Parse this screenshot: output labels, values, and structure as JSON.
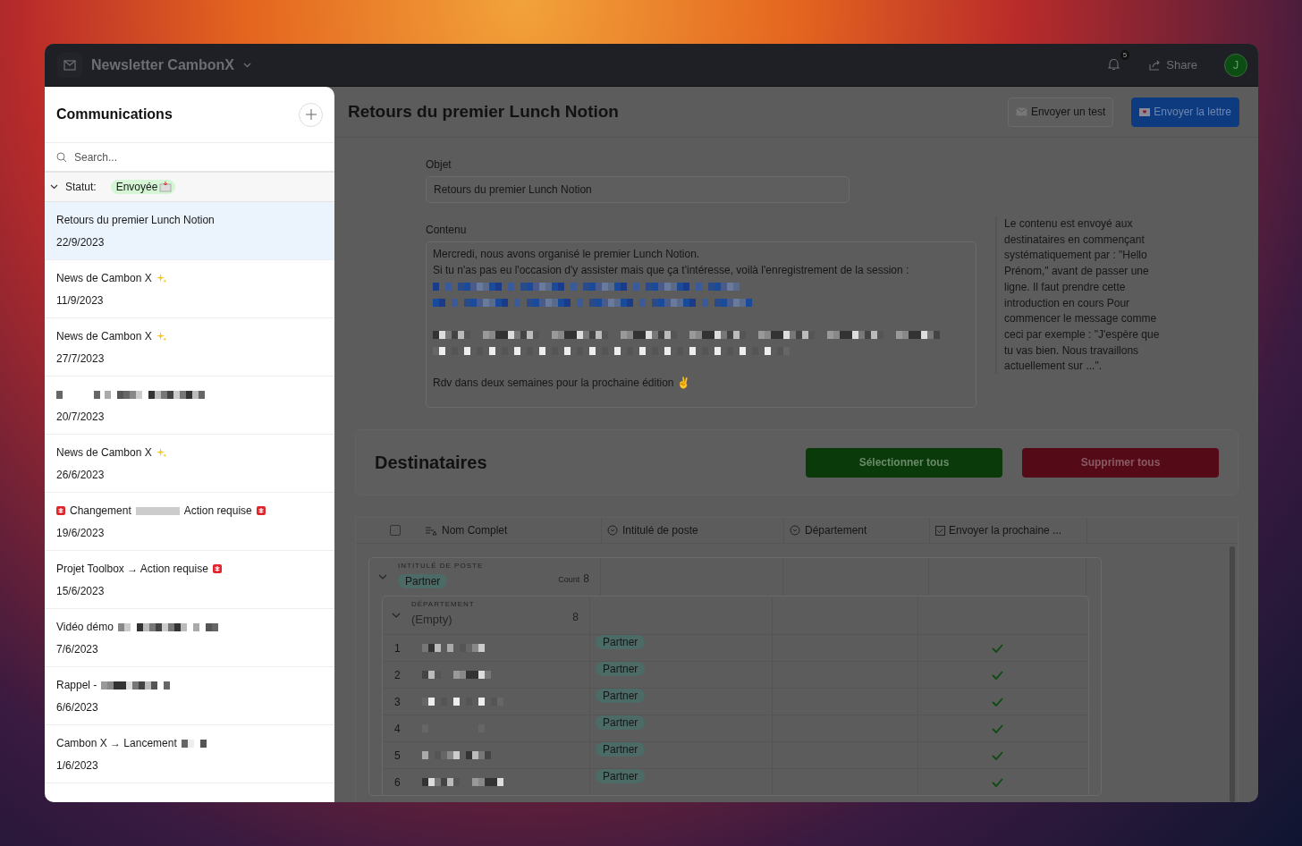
{
  "window": {
    "title": "Newsletter CambonX",
    "notifications": "5",
    "share": "Share",
    "avatar": "J"
  },
  "sidebar": {
    "title": "Communications",
    "search": {
      "placeholder": "Search..."
    },
    "filter": {
      "label": "Statut:",
      "value": "Envoyée",
      "expanded": true
    },
    "items": [
      {
        "selected": true,
        "date": "22/9/2023",
        "segments": [
          {
            "kind": "text",
            "text": "Retours du premier Lunch Notion"
          }
        ]
      },
      {
        "selected": false,
        "date": "11/9/2023",
        "segments": [
          {
            "kind": "text",
            "text": "News de Cambon X"
          },
          {
            "kind": "sparkle"
          }
        ]
      },
      {
        "selected": false,
        "date": "27/7/2023",
        "segments": [
          {
            "kind": "text",
            "text": "News de Cambon X"
          },
          {
            "kind": "sparkle"
          }
        ]
      },
      {
        "selected": false,
        "date": "20/7/2023",
        "segments": [
          {
            "kind": "redacted"
          },
          {
            "kind": "redacted"
          }
        ]
      },
      {
        "selected": false,
        "date": "26/6/2023",
        "segments": [
          {
            "kind": "text",
            "text": "News de Cambon X"
          },
          {
            "kind": "sparkle"
          }
        ]
      },
      {
        "selected": false,
        "date": "19/6/2023",
        "segments": [
          {
            "kind": "alert"
          },
          {
            "kind": "text",
            "text": "Changement"
          },
          {
            "kind": "redacted"
          },
          {
            "kind": "text",
            "text": "Action requise"
          },
          {
            "kind": "alert"
          }
        ]
      },
      {
        "selected": false,
        "date": "15/6/2023",
        "segments": [
          {
            "kind": "text",
            "text": "Projet Toolbox → Action requise"
          },
          {
            "kind": "alert"
          }
        ]
      },
      {
        "selected": false,
        "date": "7/6/2023",
        "segments": [
          {
            "kind": "text",
            "text": "Vidéo démo"
          },
          {
            "kind": "redacted"
          }
        ]
      },
      {
        "selected": false,
        "date": "6/6/2023",
        "segments": [
          {
            "kind": "text",
            "text": "Rappel -"
          },
          {
            "kind": "redacted"
          }
        ]
      },
      {
        "selected": false,
        "date": "1/6/2023",
        "segments": [
          {
            "kind": "text",
            "text": "Cambon X → Lancement"
          },
          {
            "kind": "redacted"
          }
        ]
      }
    ]
  },
  "main": {
    "title": "Retours du premier Lunch Notion",
    "buttons": [
      {
        "kind": "test",
        "label": "Envoyer un test"
      },
      {
        "kind": "send",
        "label": "Envoyer la lettre"
      }
    ],
    "subject": {
      "label": "Objet",
      "value": "Retours du premier Lunch Notion"
    },
    "content": {
      "label": "Contenu",
      "lines": [
        {
          "kind": "text",
          "text": "Mercredi, nous avons organisé le premier Lunch Notion."
        },
        {
          "kind": "text",
          "text": "Si tu n'as pas eu l'occasion d'y assister mais que ça t'intéresse, voilà l'enregistrement de la session :"
        },
        {
          "kind": "link-redacted"
        },
        {
          "kind": "link-redacted"
        },
        {
          "kind": "blank"
        },
        {
          "kind": "redacted"
        },
        {
          "kind": "redacted"
        },
        {
          "kind": "blank"
        },
        {
          "kind": "text",
          "text": "Rdv dans deux semaines pour la prochaine édition ✌"
        }
      ]
    },
    "note": "Le contenu est envoyé aux destinataires en commençant systématiquement par : \"Hello Prénom,\" avant de passer une ligne. Il faut prendre cette introduction en cours Pour commencer le message comme ceci par exemple : \"J'espère que tu vas bien. Nous travaillons actuellement sur ...\"."
  },
  "recipients": {
    "title": "Destinataires",
    "buttons": [
      {
        "kind": "select",
        "label": "Sélectionner tous"
      },
      {
        "kind": "delete",
        "label": "Supprimer tous"
      }
    ],
    "table": {
      "select_all": {
        "checked": false
      },
      "columns": [
        {
          "kind": "text",
          "label": "Nom Complet"
        },
        {
          "kind": "select",
          "label": "Intitulé de poste"
        },
        {
          "kind": "select",
          "label": "Département"
        },
        {
          "kind": "checkbox",
          "label": "Envoyer la prochaine ..."
        }
      ],
      "group": {
        "label": "INTITULÉ DE POSTE",
        "value": "Partner",
        "count_label": "Count",
        "count": "8",
        "expanded": true,
        "subgroup": {
          "label": "DÉPARTEMENT",
          "value": "(Empty)",
          "count": "8",
          "expanded": true
        },
        "rows": [
          {
            "number": "1",
            "job": "Partner",
            "send": true
          },
          {
            "number": "2",
            "job": "Partner",
            "send": true
          },
          {
            "number": "3",
            "job": "Partner",
            "send": true
          },
          {
            "number": "4",
            "job": "Partner",
            "send": true
          },
          {
            "number": "5",
            "job": "Partner",
            "send": true
          },
          {
            "number": "6",
            "job": "Partner",
            "send": true
          }
        ]
      }
    }
  }
}
